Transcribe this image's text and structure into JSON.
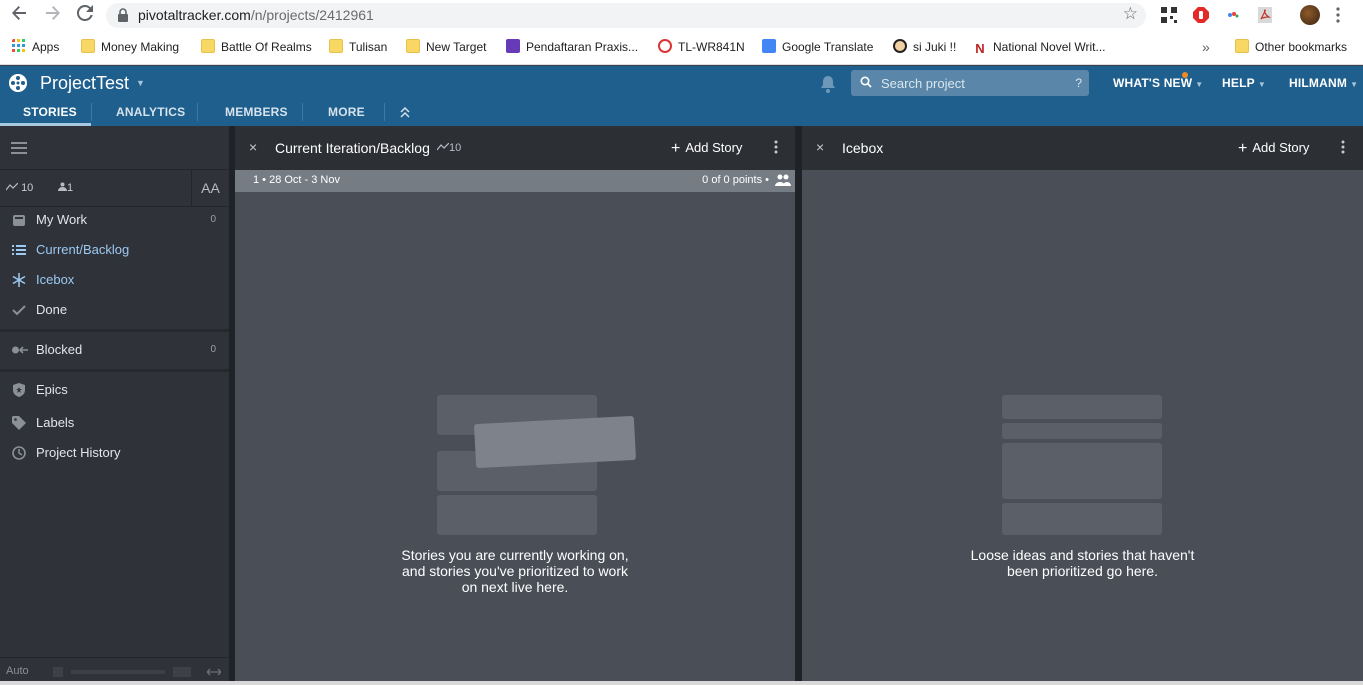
{
  "browser": {
    "url_host": "pivotaltracker.com",
    "url_path": "/n/projects/2412961",
    "bookmarks": [
      {
        "label": "Apps",
        "kind": "apps"
      },
      {
        "label": "Money Making",
        "kind": "folder"
      },
      {
        "label": "Battle Of Realms",
        "kind": "folder"
      },
      {
        "label": "Tulisan",
        "kind": "folder"
      },
      {
        "label": "New Target",
        "kind": "folder"
      },
      {
        "label": "Pendaftaran Praxis...",
        "kind": "forms"
      },
      {
        "label": "TL-WR841N",
        "kind": "tplink"
      },
      {
        "label": "Google Translate",
        "kind": "translate"
      },
      {
        "label": "si Juki !!",
        "kind": "juki"
      },
      {
        "label": "National Novel Writ...",
        "kind": "nano"
      }
    ],
    "overflow_label": "»",
    "other_bookmarks": "Other bookmarks"
  },
  "app": {
    "project_name": "ProjectTest",
    "search_placeholder": "Search project",
    "search_help": "?",
    "whats_new": "WHAT'S NEW",
    "help": "HELP",
    "user": "HILMANM",
    "tabs": [
      "STORIES",
      "ANALYTICS",
      "MEMBERS",
      "MORE"
    ],
    "accent": "#1e5f8d"
  },
  "sidebar": {
    "velocity": "10",
    "members": "1",
    "text_size": "AA",
    "items": [
      {
        "label": "My Work",
        "count": "0"
      },
      {
        "label": "Current/Backlog",
        "count": ""
      },
      {
        "label": "Icebox",
        "count": ""
      },
      {
        "label": "Done",
        "count": ""
      },
      {
        "label": "Blocked",
        "count": "0"
      },
      {
        "label": "Epics",
        "count": ""
      },
      {
        "label": "Labels",
        "count": ""
      },
      {
        "label": "Project History",
        "count": ""
      }
    ],
    "footer_mode": "Auto"
  },
  "panels": {
    "backlog": {
      "close": "×",
      "title": "Current Iteration/Backlog",
      "velocity": "10",
      "add_story": "Add Story",
      "iteration_label": "1 • 28 Oct - 3 Nov",
      "points": "0 of 0 points •",
      "empty_line1": "Stories you are currently working on,",
      "empty_line2": "and stories you've prioritized to work",
      "empty_line3": "on next live here."
    },
    "icebox": {
      "close": "×",
      "title": "Icebox",
      "add_story": "Add Story",
      "empty_line1": "Loose ideas and stories that haven't",
      "empty_line2": "been prioritized go here."
    }
  }
}
